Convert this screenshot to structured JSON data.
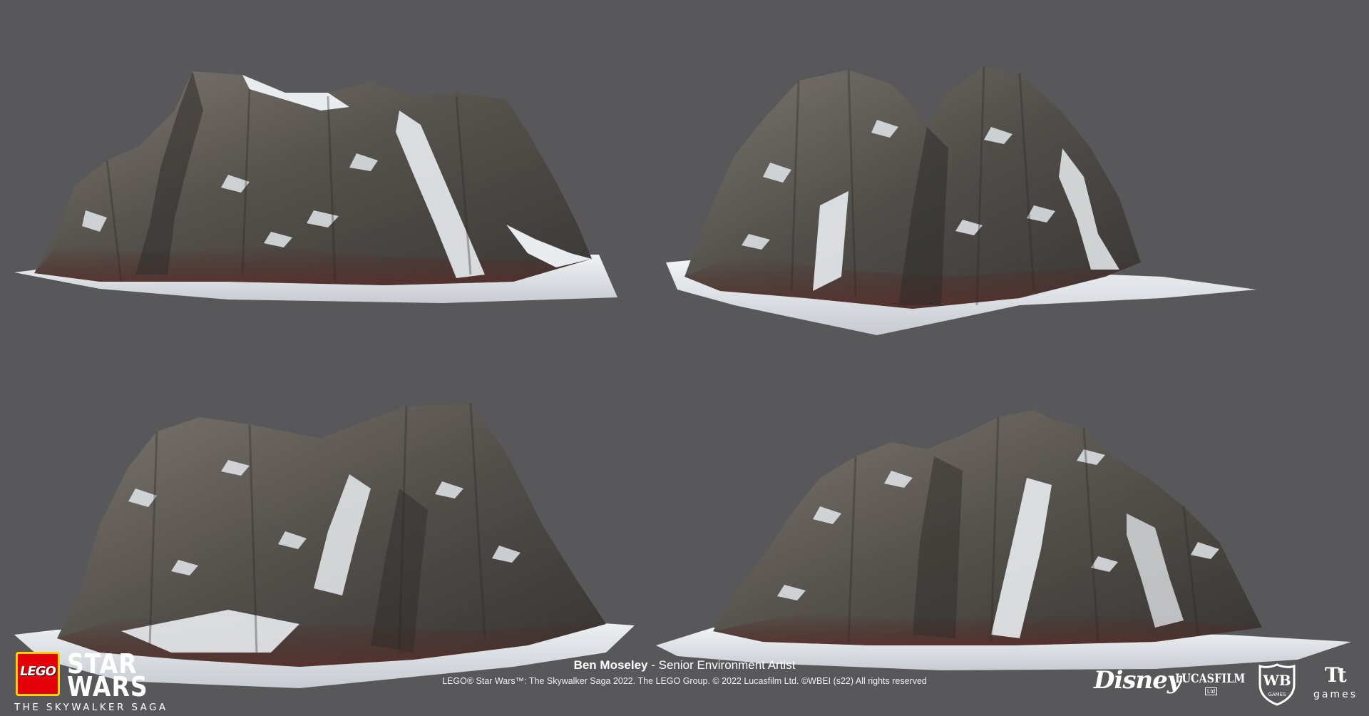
{
  "renders": [
    {
      "name": "mountain-render-top-left"
    },
    {
      "name": "mountain-render-top-right"
    },
    {
      "name": "mountain-render-bottom-left"
    },
    {
      "name": "mountain-render-bottom-right"
    }
  ],
  "colors": {
    "background": "#58585a",
    "rock_dark": "#3e3c3a",
    "rock_mid": "#5f5b56",
    "rock_light": "#8a857e",
    "rock_red": "#5a2f2b",
    "snow": "#e9ecef",
    "snow_shadow": "#c4c9cf",
    "text": "#ffffff",
    "lego_red": "#e3000b",
    "lego_yellow": "#ffd400"
  },
  "game_logo": {
    "lego": "LEGO",
    "star": "STAR",
    "wars": "WARS",
    "subtitle": "THE SKYWALKER SAGA"
  },
  "credit": {
    "name": "Ben Moseley",
    "separator": " - ",
    "role": "Senior Environment Artist",
    "copyright": "LEGO® Star Wars™: The Skywalker Saga 2022. The LEGO Group. © 2022 Lucasfilm Ltd. ©WBEI (s22) All rights reserved"
  },
  "partner_logos": {
    "disney": "Disney",
    "separator": "·",
    "lucasfilm": "LUCASFILM",
    "lucasfilm_ltd": "Ltd",
    "wb": "WB",
    "wb_games": "GAMES",
    "tt": "Tt",
    "tt_games": "games"
  }
}
